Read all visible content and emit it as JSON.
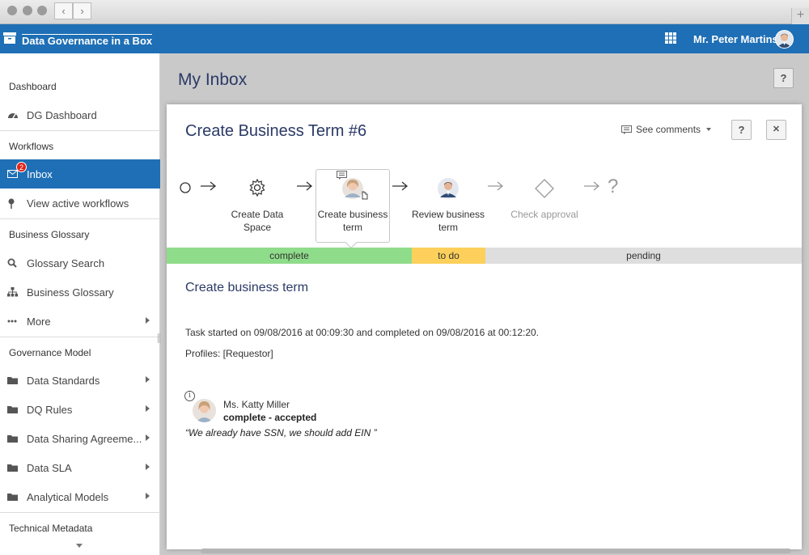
{
  "browser": {
    "back_glyph": "‹",
    "forward_glyph": "›",
    "new_tab_glyph": "+"
  },
  "app": {
    "title": "Data Governance in a Box",
    "user_name": "Mr. Peter Martins",
    "brand_color": "#1e6fb5"
  },
  "sidebar": {
    "sections": {
      "dashboard": "Dashboard",
      "workflows": "Workflows",
      "business_glossary": "Business Glossary",
      "governance_model": "Governance Model",
      "technical_metadata": "Technical Metadata"
    },
    "items": {
      "dg_dashboard": {
        "label": "DG Dashboard",
        "icon": "dashboard-icon"
      },
      "inbox": {
        "label": "Inbox",
        "icon": "envelope-icon",
        "badge": "2"
      },
      "view_active_workflows": {
        "label": "View active workflows",
        "icon": "pin-icon"
      },
      "glossary_search": {
        "label": "Glossary Search",
        "icon": "search-icon"
      },
      "business_glossary": {
        "label": "Business Glossary",
        "icon": "hierarchy-icon"
      },
      "more": {
        "label": "More",
        "icon": "ellipsis-icon"
      },
      "data_standards": {
        "label": "Data Standards",
        "icon": "folder-icon"
      },
      "dq_rules": {
        "label": "DQ Rules",
        "icon": "folder-icon"
      },
      "data_sharing_agreements": {
        "label": "Data Sharing Agreeme...",
        "icon": "folder-icon"
      },
      "data_sla": {
        "label": "Data SLA",
        "icon": "folder-icon"
      },
      "analytical_models": {
        "label": "Analytical Models",
        "icon": "folder-icon"
      }
    }
  },
  "main": {
    "page_title": "My Inbox",
    "help_label": "?"
  },
  "modal": {
    "title": "Create Business Term #6",
    "see_comments_label": "See comments",
    "help_label": "?",
    "close_label": "✕",
    "workflow": {
      "steps": {
        "create_data_space": "Create Data Space",
        "create_business_term": "Create business term",
        "review_business_term": "Review business term",
        "check_approval": "Check approval"
      },
      "end_glyph": "?"
    },
    "status": {
      "complete": "complete",
      "todo": "to do",
      "pending": "pending",
      "complete_color": "#8fdc8a",
      "todo_color": "#fcd05a",
      "pending_color": "#dedede"
    },
    "task": {
      "title": "Create business term",
      "started_text": "Task started on 09/08/2016 at 00:09:30 and completed on 09/08/2016 at 00:12:20.",
      "profiles_text": "Profiles: [Requestor]",
      "info_glyph": "i",
      "commenter_name": "Ms. Katty Miller",
      "commenter_status": "complete - accepted",
      "comment": "“We already have SSN, we should add EIN ”"
    }
  }
}
